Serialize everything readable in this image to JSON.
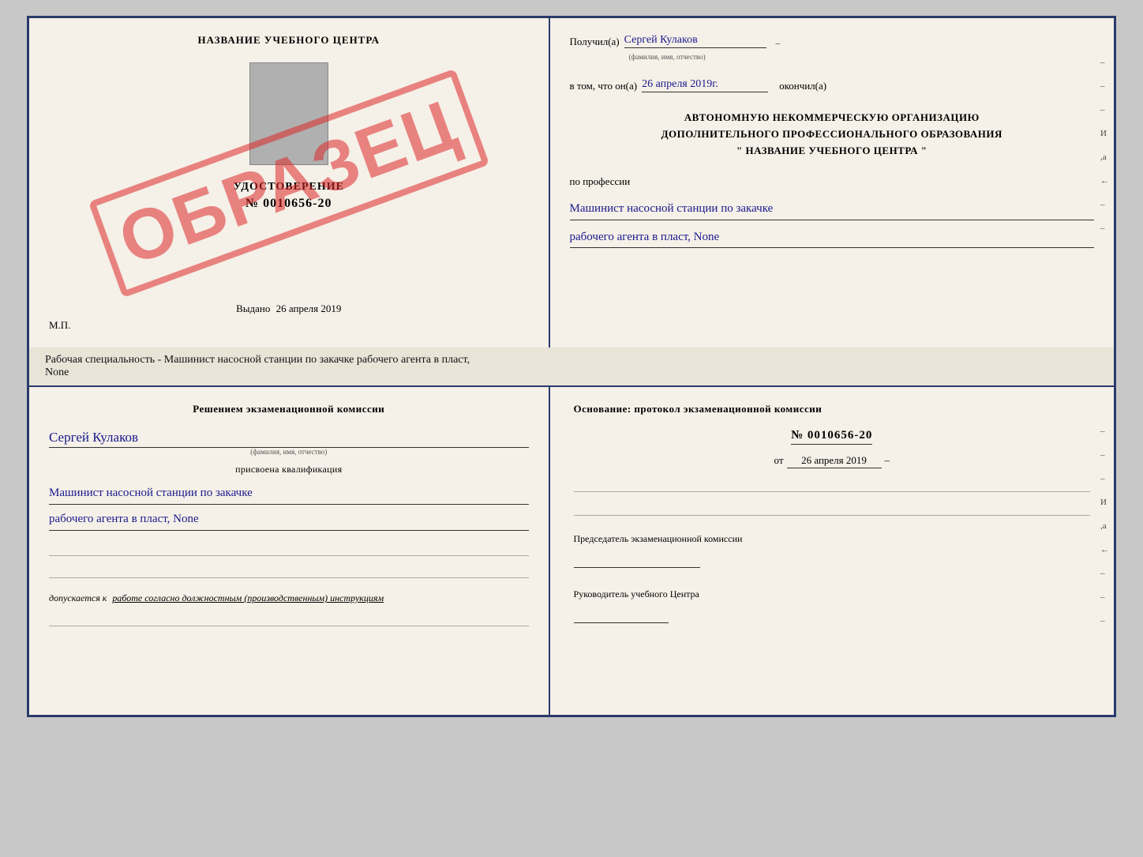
{
  "cert_top": {
    "left": {
      "title": "НАЗВАНИЕ УЧЕБНОГО ЦЕНТРА",
      "watermark": "ОБРАЗЕЦ",
      "udost_label": "УДОСТОВЕРЕНИЕ",
      "udost_number": "№ 0010656-20",
      "vydano_label": "Выдано",
      "vydano_date": "26 апреля 2019",
      "mp_label": "М.П."
    },
    "right": {
      "poluchil_label": "Получил(а)",
      "poluchil_value": "Сергей Кулаков",
      "familiya_hint": "(фамилия, имя, отчество)",
      "vtom_label": "в том, что он(а)",
      "vtom_value": "26 апреля 2019г.",
      "okonchil_label": "окончил(а)",
      "org_line1": "АВТОНОМНУЮ НЕКОММЕРЧЕСКУЮ ОРГАНИЗАЦИЮ",
      "org_line2": "ДОПОЛНИТЕЛЬНОГО ПРОФЕССИОНАЛЬНОГО ОБРАЗОВАНИЯ",
      "org_line3": "\"   НАЗВАНИЕ УЧЕБНОГО ЦЕНТРА   \"",
      "po_professii": "по профессии",
      "profession_line1": "Машинист насосной станции по закачке",
      "profession_line2": "рабочего агента в пласт, None",
      "side_marks": [
        "-",
        "-",
        "-",
        "И",
        ",а",
        "←",
        "-",
        "-"
      ]
    }
  },
  "subtitle": "Рабочая специальность - Машинист насосной станции по закачке рабочего агента в пласт,",
  "subtitle2": "None",
  "cert_bottom": {
    "left": {
      "komissia_title": "Решением экзаменационной комиссии",
      "name_value": "Сергей Кулаков",
      "name_subtext": "(фамилия, имя, отчество)",
      "prisvoena_label": "присвоена квалификация",
      "qual_line1": "Машинист насосной станции по закачке",
      "qual_line2": "рабочего агента в пласт, None",
      "dopusk_label": "допускается к",
      "dopusk_value": "работе согласно должностным (производственным) инструкциям"
    },
    "right": {
      "osnovanie_label": "Основание: протокол экзаменационной комиссии",
      "protocol_number": "№  0010656-20",
      "ot_label": "от",
      "ot_date": "26 апреля 2019",
      "predsedatel_label": "Председатель экзаменационной комиссии",
      "rukovoditel_label": "Руководитель учебного Центра",
      "side_marks": [
        "-",
        "-",
        "-",
        "И",
        ",а",
        "←",
        "-",
        "-",
        "-"
      ]
    }
  }
}
